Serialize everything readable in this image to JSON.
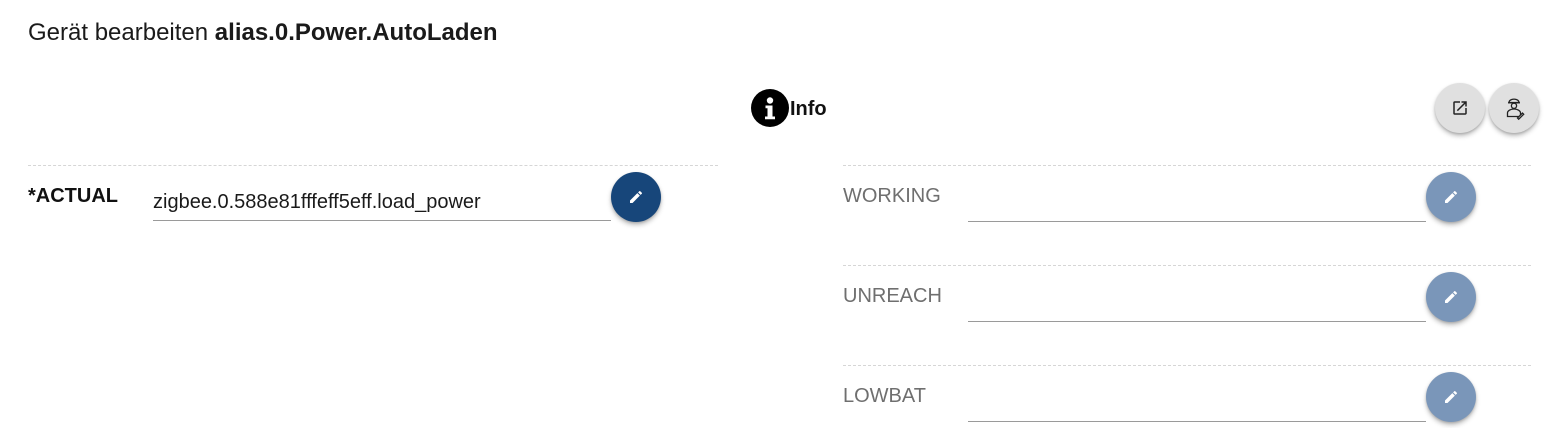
{
  "header": {
    "title_prefix": "Gerät bearbeiten",
    "device_id": "alias.0.Power.AutoLaden"
  },
  "info_section": {
    "icon": "info-icon",
    "label": "Info"
  },
  "toolbar": {
    "open_icon": "open-in-new-icon",
    "expert_icon": "expert-mode-icon"
  },
  "left_fields": [
    {
      "label": "*ACTUAL",
      "value": "zigbee.0.588e81fffeff5eff.load_power",
      "edit_icon": "pencil-icon"
    }
  ],
  "right_fields": [
    {
      "label": "WORKING",
      "value": "",
      "edit_icon": "pencil-icon"
    },
    {
      "label": "UNREACH",
      "value": "",
      "edit_icon": "pencil-icon"
    },
    {
      "label": "LOWBAT",
      "value": "",
      "edit_icon": "pencil-icon"
    }
  ],
  "colors": {
    "edit_active": "#17467a",
    "edit_inactive": "#7a96b9",
    "muted_label": "#6f6f6f"
  }
}
